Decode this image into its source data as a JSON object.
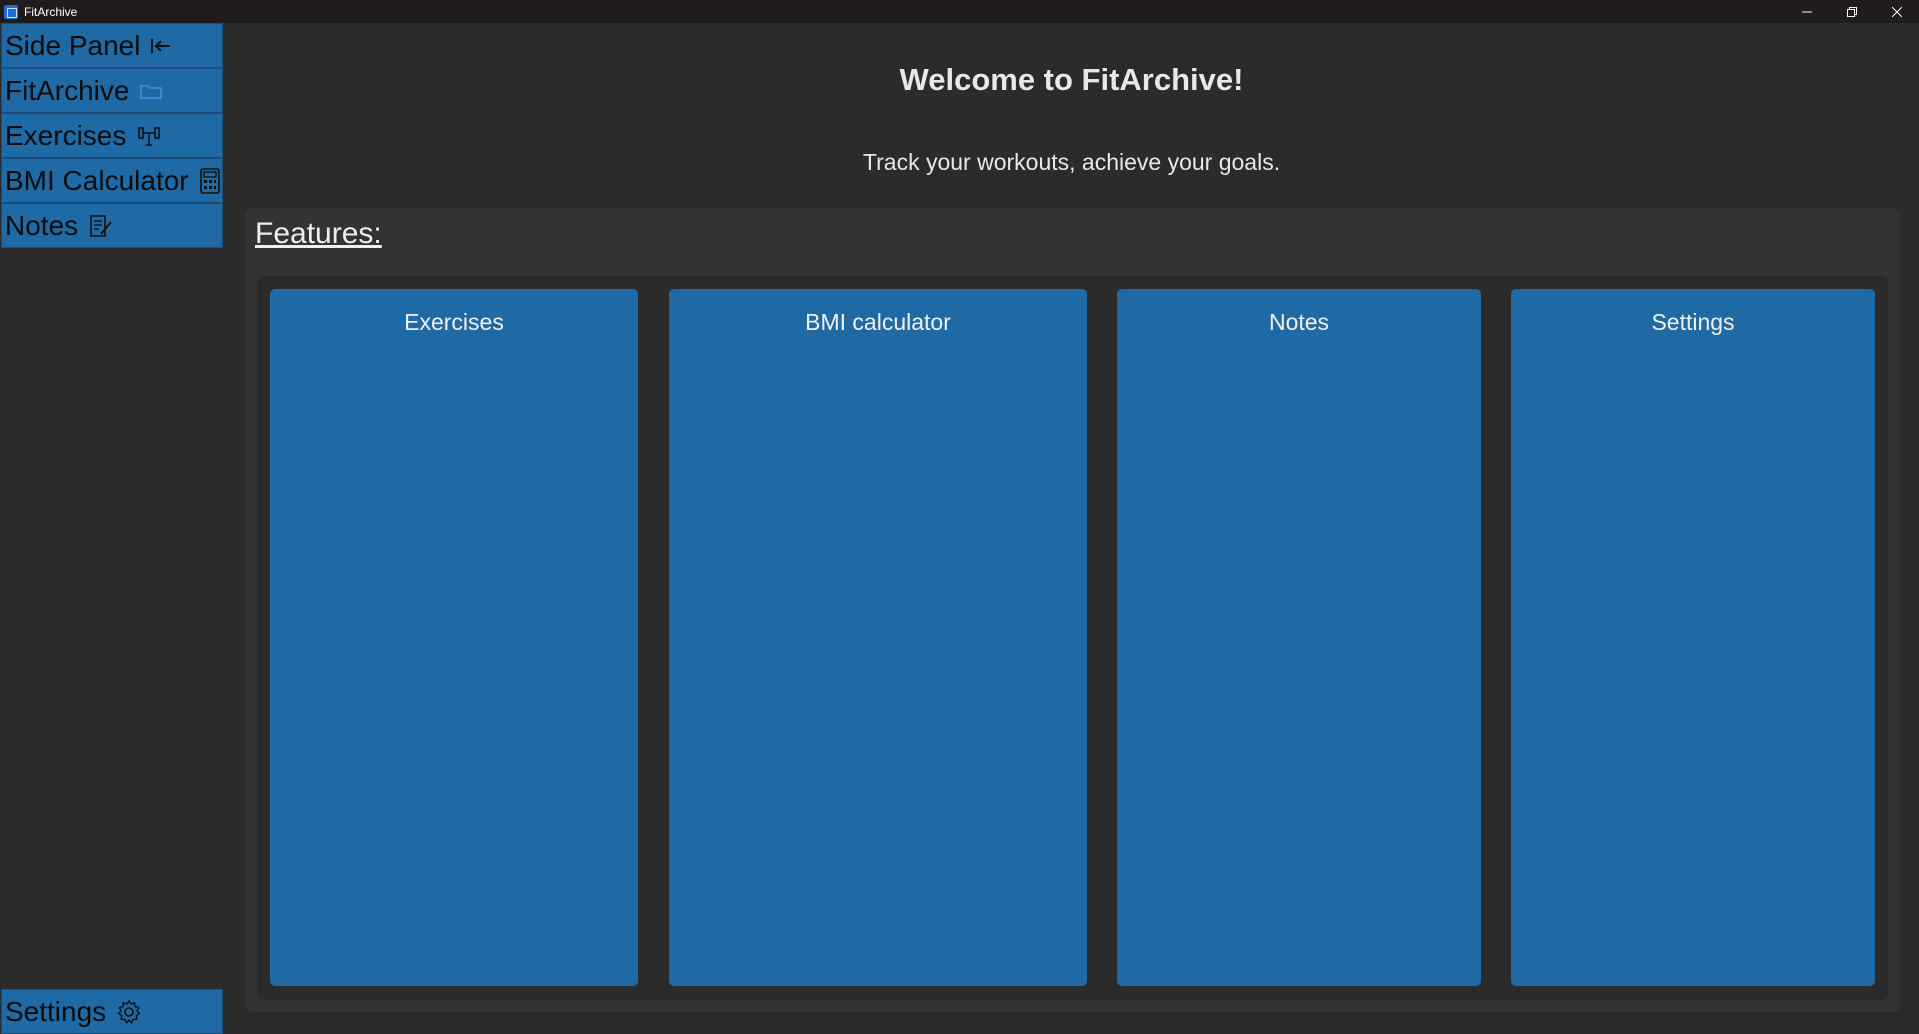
{
  "window": {
    "title": "FitArchive",
    "controls": [
      "minimize",
      "restore",
      "close"
    ]
  },
  "sidebar": {
    "items": [
      {
        "label": "Side Panel",
        "icon": "collapse-left-icon"
      },
      {
        "label": "FitArchive",
        "icon": "folder-icon"
      },
      {
        "label": "Exercises",
        "icon": "dumbbell-icon"
      },
      {
        "label": "BMI Calculator",
        "icon": "calculator-icon"
      },
      {
        "label": "Notes",
        "icon": "notes-icon"
      }
    ],
    "bottom_item": {
      "label": "Settings",
      "icon": "gear-icon"
    }
  },
  "main": {
    "title": "Welcome to FitArchive!",
    "tagline": "Track your workouts, achieve your goals.",
    "features_label": "Features:",
    "cards": [
      {
        "label": "Exercises"
      },
      {
        "label": "BMI calculator"
      },
      {
        "label": "Notes"
      },
      {
        "label": "Settings"
      }
    ]
  },
  "colors": {
    "accent": "#1f6aa5",
    "background": "#2b2b2b",
    "panel": "#333333",
    "titlebar": "#201c1c",
    "text": "#e8e8e8"
  }
}
